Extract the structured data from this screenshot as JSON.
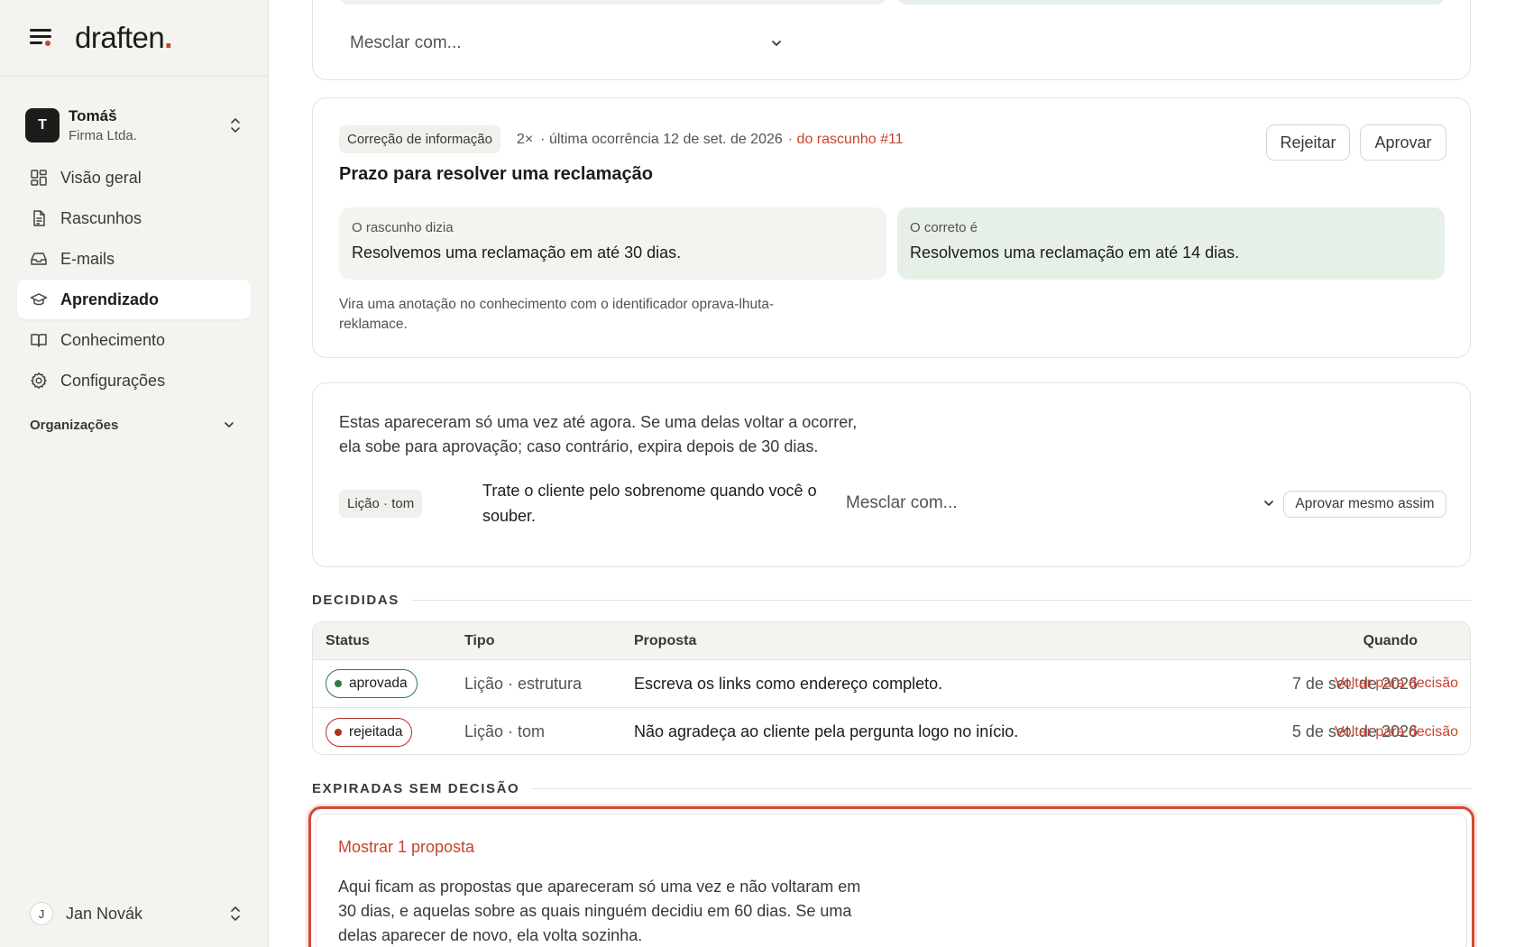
{
  "app": {
    "logo": "draften",
    "logo_dot": "."
  },
  "account": {
    "initial": "T",
    "name": "Tomáš",
    "company": "Firma Ltda."
  },
  "nav": [
    {
      "label": "Visão geral",
      "icon": "grid-icon"
    },
    {
      "label": "Rascunhos",
      "icon": "document-icon"
    },
    {
      "label": "E-mails",
      "icon": "inbox-icon"
    },
    {
      "label": "Aprendizado",
      "icon": "graduation-cap-icon",
      "active": true
    },
    {
      "label": "Conhecimento",
      "icon": "book-icon"
    },
    {
      "label": "Configurações",
      "icon": "gear-icon"
    }
  ],
  "organizations_label": "Organizações",
  "user": {
    "initial": "J",
    "name": "Jan Novák"
  },
  "top_card": {
    "merge_placeholder": "Mesclar com..."
  },
  "fix_card": {
    "type_pill": "Correção de informação",
    "count": "2×",
    "last_seen": "· última ocorrência 12 de set. de 2026",
    "source_link": "· do rascunho #11",
    "reject": "Rejeitar",
    "approve": "Aprovar",
    "title": "Prazo para resolver uma reclamação",
    "old_label": "O rascunho dizia",
    "old_value": "Resolvemos uma reclamação em até 30 dias.",
    "new_label": "O correto é",
    "new_value": "Resolvemos uma reclamação em até 14 dias.",
    "note": "Vira uma anotação no conhecimento com o identificador oprava-lhuta-reklamace."
  },
  "single_card": {
    "intro": "Estas apareceram só uma vez até agora. Se uma delas voltar a ocorrer, ela sobe para aprovação; caso contrário, expira depois de 30 dias.",
    "pill": "Lição · tom",
    "lesson": "Trate o cliente pelo sobrenome quando você o souber.",
    "merge_placeholder": "Mesclar com...",
    "approve_anyway": "Aprovar mesmo assim"
  },
  "decided": {
    "heading": "DECIDIDAS",
    "columns": {
      "status": "Status",
      "type": "Tipo",
      "proposal": "Proposta",
      "when": "Quando"
    },
    "rows": [
      {
        "status": "aprovada",
        "type": "Lição · estrutura",
        "proposal": "Escreva os links como endereço completo.",
        "when": "7 de set. de 2026",
        "action": "Voltar para decisão"
      },
      {
        "status": "rejeitada",
        "type": "Lição · tom",
        "proposal": "Não agradeça ao cliente pela pergunta logo no início.",
        "when": "5 de set. de 2026",
        "action": "Voltar para decisão"
      }
    ]
  },
  "expired": {
    "heading": "EXPIRADAS SEM DECISÃO",
    "show_link": "Mostrar 1 proposta",
    "text": "Aqui ficam as propostas que apareceram só uma vez e não voltaram em 30 dias, e aquelas sobre as quais ninguém decidiu em 60 dias. Se uma delas aparecer de novo, ela volta sozinha."
  },
  "colors": {
    "accent": "#c9432c",
    "approved": "#2e7a4d",
    "rejected": "#b32f23",
    "correct_bg": "#e6f0e7"
  }
}
